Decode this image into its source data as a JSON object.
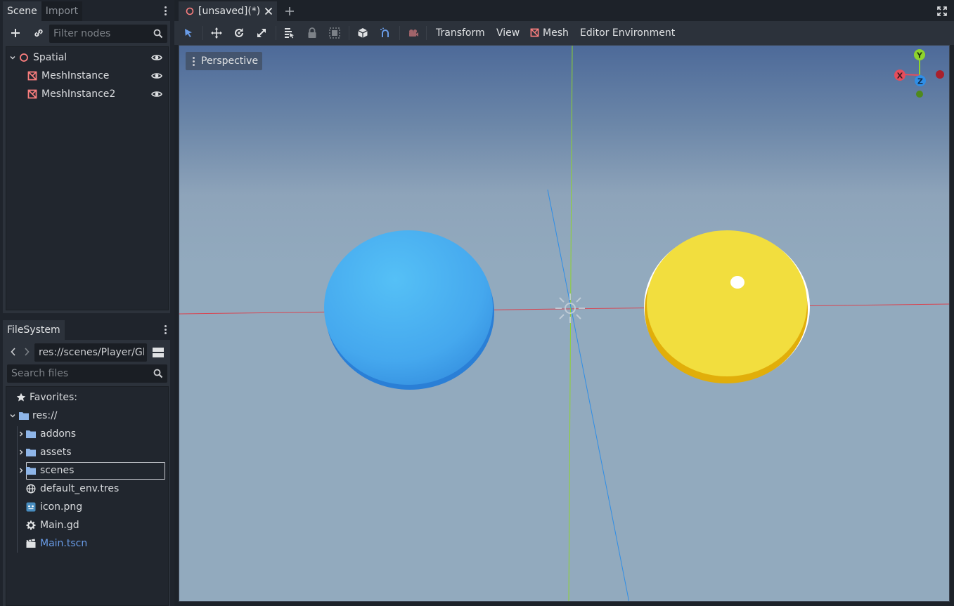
{
  "scene_dock": {
    "tabs": [
      "Scene",
      "Import"
    ],
    "filter_placeholder": "Filter nodes",
    "tree": [
      {
        "label": "Spatial",
        "type": "spatial"
      },
      {
        "label": "MeshInstance",
        "type": "mesh"
      },
      {
        "label": "MeshInstance2",
        "type": "mesh"
      }
    ]
  },
  "filesystem_dock": {
    "tab": "FileSystem",
    "path": "res://scenes/Player/Gl",
    "search_placeholder": "Search files",
    "favorites": "Favorites:",
    "root": "res://",
    "items": [
      {
        "label": "addons",
        "type": "folder"
      },
      {
        "label": "assets",
        "type": "folder"
      },
      {
        "label": "scenes",
        "type": "folder"
      },
      {
        "label": "default_env.tres",
        "type": "environment"
      },
      {
        "label": "icon.png",
        "type": "image"
      },
      {
        "label": "Main.gd",
        "type": "script"
      },
      {
        "label": "Main.tscn",
        "type": "scene"
      }
    ]
  },
  "editor": {
    "scene_tab": "[unsaved](*)",
    "menus": {
      "transform": "Transform",
      "view": "View",
      "mesh": "Mesh",
      "environment": "Editor Environment"
    },
    "viewport_label": "Perspective",
    "gizmo": {
      "y": "Y",
      "x": "X",
      "z": "Z"
    }
  },
  "colors": {
    "accent": "#699ce8",
    "mesh_icon": "#fc7f7f",
    "sphere_blue": "#48aef0",
    "disc_yellow": "#f2de3e",
    "axis_x": "#e64d5c",
    "axis_y": "#8ed42c",
    "axis_z": "#2f8ee6"
  }
}
